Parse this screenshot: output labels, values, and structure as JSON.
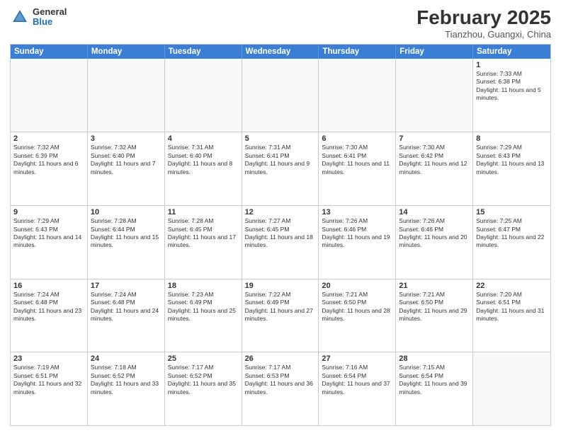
{
  "header": {
    "logo_general": "General",
    "logo_blue": "Blue",
    "month_year": "February 2025",
    "location": "Tianzhou, Guangxi, China"
  },
  "days_of_week": [
    "Sunday",
    "Monday",
    "Tuesday",
    "Wednesday",
    "Thursday",
    "Friday",
    "Saturday"
  ],
  "weeks": [
    [
      {
        "day": "",
        "sunrise": "",
        "sunset": "",
        "daylight": ""
      },
      {
        "day": "",
        "sunrise": "",
        "sunset": "",
        "daylight": ""
      },
      {
        "day": "",
        "sunrise": "",
        "sunset": "",
        "daylight": ""
      },
      {
        "day": "",
        "sunrise": "",
        "sunset": "",
        "daylight": ""
      },
      {
        "day": "",
        "sunrise": "",
        "sunset": "",
        "daylight": ""
      },
      {
        "day": "",
        "sunrise": "",
        "sunset": "",
        "daylight": ""
      },
      {
        "day": "1",
        "sunrise": "Sunrise: 7:33 AM",
        "sunset": "Sunset: 6:38 PM",
        "daylight": "Daylight: 11 hours and 5 minutes."
      }
    ],
    [
      {
        "day": "2",
        "sunrise": "Sunrise: 7:32 AM",
        "sunset": "Sunset: 6:39 PM",
        "daylight": "Daylight: 11 hours and 6 minutes."
      },
      {
        "day": "3",
        "sunrise": "Sunrise: 7:32 AM",
        "sunset": "Sunset: 6:40 PM",
        "daylight": "Daylight: 11 hours and 7 minutes."
      },
      {
        "day": "4",
        "sunrise": "Sunrise: 7:31 AM",
        "sunset": "Sunset: 6:40 PM",
        "daylight": "Daylight: 11 hours and 8 minutes."
      },
      {
        "day": "5",
        "sunrise": "Sunrise: 7:31 AM",
        "sunset": "Sunset: 6:41 PM",
        "daylight": "Daylight: 11 hours and 9 minutes."
      },
      {
        "day": "6",
        "sunrise": "Sunrise: 7:30 AM",
        "sunset": "Sunset: 6:41 PM",
        "daylight": "Daylight: 11 hours and 11 minutes."
      },
      {
        "day": "7",
        "sunrise": "Sunrise: 7:30 AM",
        "sunset": "Sunset: 6:42 PM",
        "daylight": "Daylight: 11 hours and 12 minutes."
      },
      {
        "day": "8",
        "sunrise": "Sunrise: 7:29 AM",
        "sunset": "Sunset: 6:43 PM",
        "daylight": "Daylight: 11 hours and 13 minutes."
      }
    ],
    [
      {
        "day": "9",
        "sunrise": "Sunrise: 7:29 AM",
        "sunset": "Sunset: 6:43 PM",
        "daylight": "Daylight: 11 hours and 14 minutes."
      },
      {
        "day": "10",
        "sunrise": "Sunrise: 7:28 AM",
        "sunset": "Sunset: 6:44 PM",
        "daylight": "Daylight: 11 hours and 15 minutes."
      },
      {
        "day": "11",
        "sunrise": "Sunrise: 7:28 AM",
        "sunset": "Sunset: 6:45 PM",
        "daylight": "Daylight: 11 hours and 17 minutes."
      },
      {
        "day": "12",
        "sunrise": "Sunrise: 7:27 AM",
        "sunset": "Sunset: 6:45 PM",
        "daylight": "Daylight: 11 hours and 18 minutes."
      },
      {
        "day": "13",
        "sunrise": "Sunrise: 7:26 AM",
        "sunset": "Sunset: 6:46 PM",
        "daylight": "Daylight: 11 hours and 19 minutes."
      },
      {
        "day": "14",
        "sunrise": "Sunrise: 7:26 AM",
        "sunset": "Sunset: 6:46 PM",
        "daylight": "Daylight: 11 hours and 20 minutes."
      },
      {
        "day": "15",
        "sunrise": "Sunrise: 7:25 AM",
        "sunset": "Sunset: 6:47 PM",
        "daylight": "Daylight: 11 hours and 22 minutes."
      }
    ],
    [
      {
        "day": "16",
        "sunrise": "Sunrise: 7:24 AM",
        "sunset": "Sunset: 6:48 PM",
        "daylight": "Daylight: 11 hours and 23 minutes."
      },
      {
        "day": "17",
        "sunrise": "Sunrise: 7:24 AM",
        "sunset": "Sunset: 6:48 PM",
        "daylight": "Daylight: 11 hours and 24 minutes."
      },
      {
        "day": "18",
        "sunrise": "Sunrise: 7:23 AM",
        "sunset": "Sunset: 6:49 PM",
        "daylight": "Daylight: 11 hours and 25 minutes."
      },
      {
        "day": "19",
        "sunrise": "Sunrise: 7:22 AM",
        "sunset": "Sunset: 6:49 PM",
        "daylight": "Daylight: 11 hours and 27 minutes."
      },
      {
        "day": "20",
        "sunrise": "Sunrise: 7:21 AM",
        "sunset": "Sunset: 6:50 PM",
        "daylight": "Daylight: 11 hours and 28 minutes."
      },
      {
        "day": "21",
        "sunrise": "Sunrise: 7:21 AM",
        "sunset": "Sunset: 6:50 PM",
        "daylight": "Daylight: 11 hours and 29 minutes."
      },
      {
        "day": "22",
        "sunrise": "Sunrise: 7:20 AM",
        "sunset": "Sunset: 6:51 PM",
        "daylight": "Daylight: 11 hours and 31 minutes."
      }
    ],
    [
      {
        "day": "23",
        "sunrise": "Sunrise: 7:19 AM",
        "sunset": "Sunset: 6:51 PM",
        "daylight": "Daylight: 11 hours and 32 minutes."
      },
      {
        "day": "24",
        "sunrise": "Sunrise: 7:18 AM",
        "sunset": "Sunset: 6:52 PM",
        "daylight": "Daylight: 11 hours and 33 minutes."
      },
      {
        "day": "25",
        "sunrise": "Sunrise: 7:17 AM",
        "sunset": "Sunset: 6:52 PM",
        "daylight": "Daylight: 11 hours and 35 minutes."
      },
      {
        "day": "26",
        "sunrise": "Sunrise: 7:17 AM",
        "sunset": "Sunset: 6:53 PM",
        "daylight": "Daylight: 11 hours and 36 minutes."
      },
      {
        "day": "27",
        "sunrise": "Sunrise: 7:16 AM",
        "sunset": "Sunset: 6:54 PM",
        "daylight": "Daylight: 11 hours and 37 minutes."
      },
      {
        "day": "28",
        "sunrise": "Sunrise: 7:15 AM",
        "sunset": "Sunset: 6:54 PM",
        "daylight": "Daylight: 11 hours and 39 minutes."
      },
      {
        "day": "",
        "sunrise": "",
        "sunset": "",
        "daylight": ""
      }
    ]
  ]
}
